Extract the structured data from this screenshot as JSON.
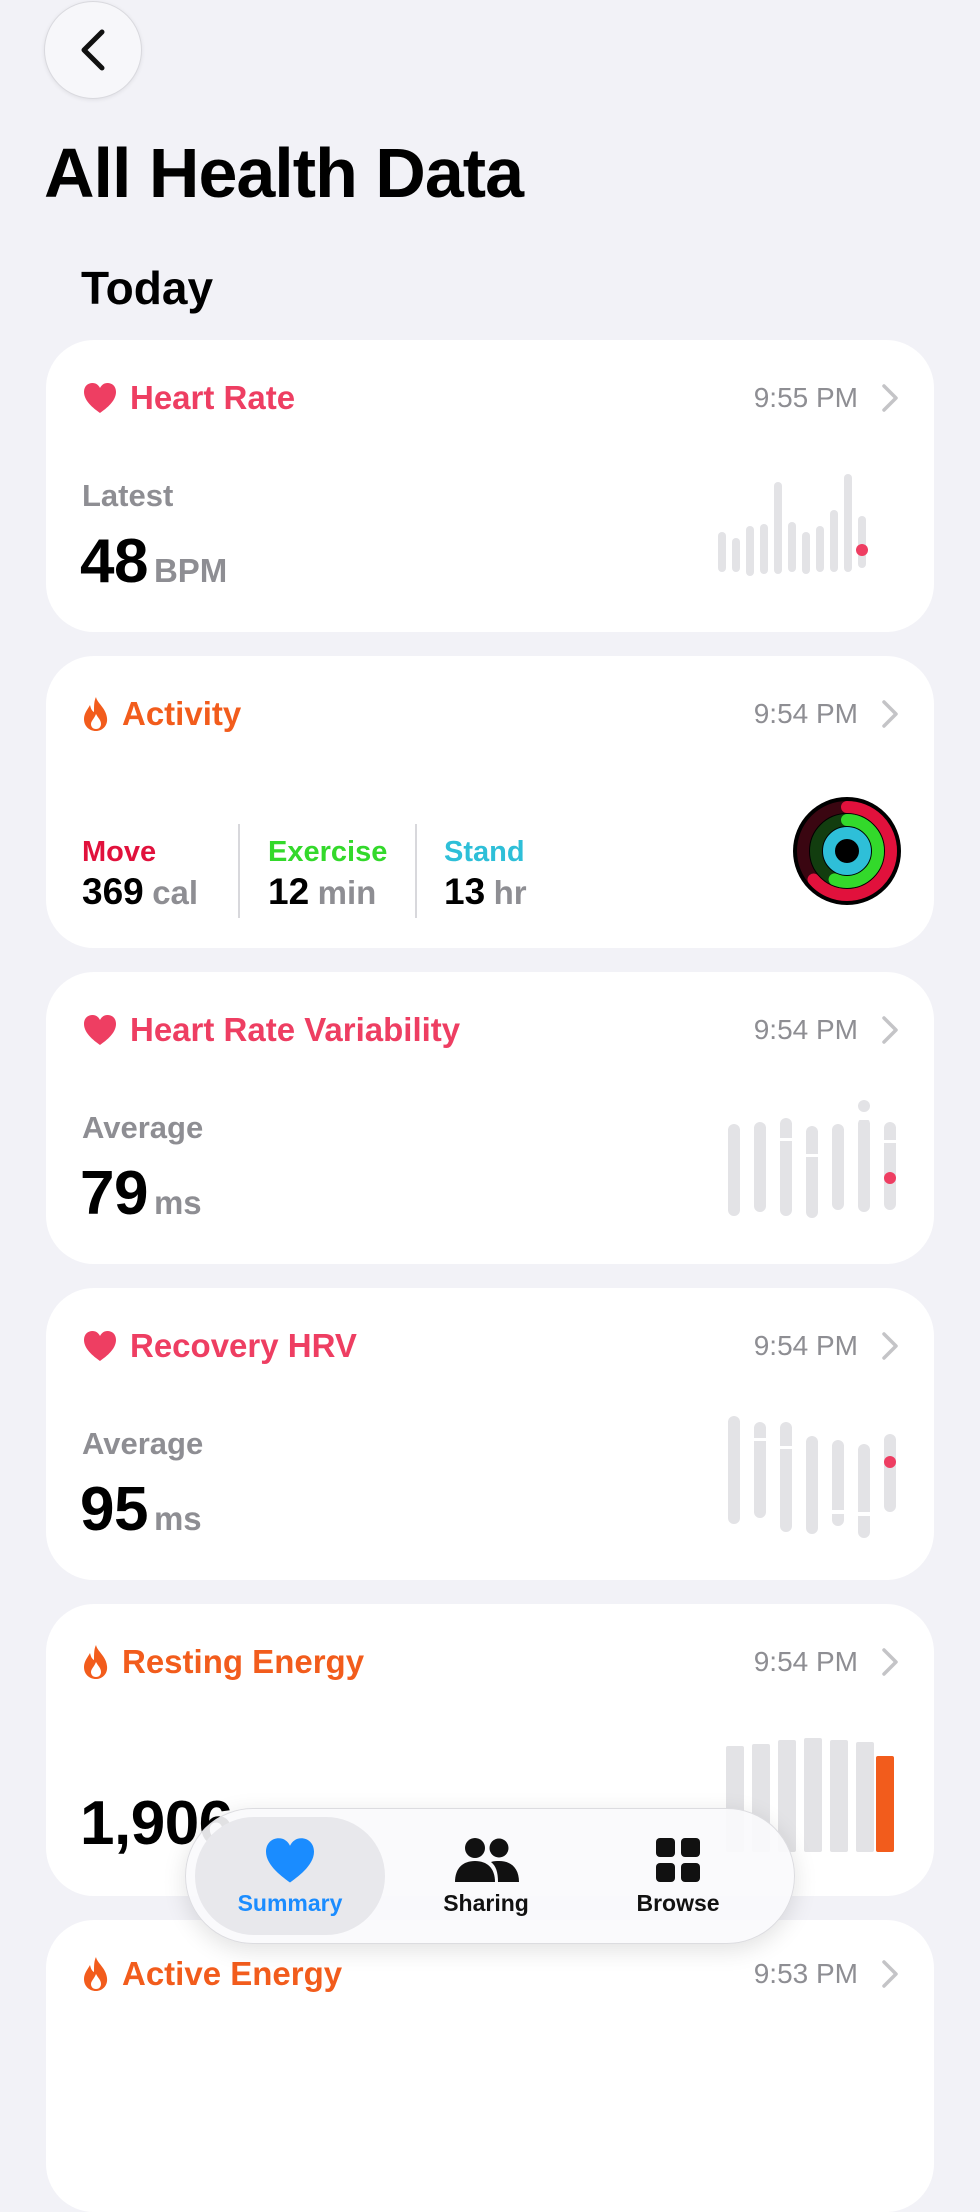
{
  "header": {
    "back_label": "Back",
    "title": "All Health Data",
    "section": "Today"
  },
  "colors": {
    "heart": "#ee3e62",
    "activity": "#f25c1c",
    "move": "#e1113c",
    "exercise": "#33d92b",
    "stand": "#2ebfd8",
    "tab_active": "#1a8cff"
  },
  "cards": [
    {
      "title": "Heart Rate",
      "icon": "heart-icon",
      "time": "9:55 PM",
      "metric_label": "Latest",
      "value": "48",
      "unit": "BPM"
    },
    {
      "title": "Activity",
      "icon": "flame-icon",
      "time": "9:54 PM",
      "move_label": "Move",
      "move_value": "369",
      "move_unit": "cal",
      "exercise_label": "Exercise",
      "exercise_value": "12",
      "exercise_unit": "min",
      "stand_label": "Stand",
      "stand_value": "13",
      "stand_unit": "hr"
    },
    {
      "title": "Heart Rate Variability",
      "icon": "heart-icon",
      "time": "9:54 PM",
      "metric_label": "Average",
      "value": "79",
      "unit": "ms"
    },
    {
      "title": "Recovery HRV",
      "icon": "heart-icon",
      "time": "9:54 PM",
      "metric_label": "Average",
      "value": "95",
      "unit": "ms"
    },
    {
      "title": "Resting Energy",
      "icon": "flame-icon",
      "time": "9:54 PM",
      "value": "1,906"
    },
    {
      "title": "Active Energy",
      "icon": "flame-icon",
      "time": "9:53 PM"
    }
  ],
  "tabbar": {
    "tabs": [
      {
        "label": "Summary",
        "icon": "heart-icon",
        "active": true
      },
      {
        "label": "Sharing",
        "icon": "people-icon",
        "active": false
      },
      {
        "label": "Browse",
        "icon": "grid-icon",
        "active": false
      }
    ]
  }
}
